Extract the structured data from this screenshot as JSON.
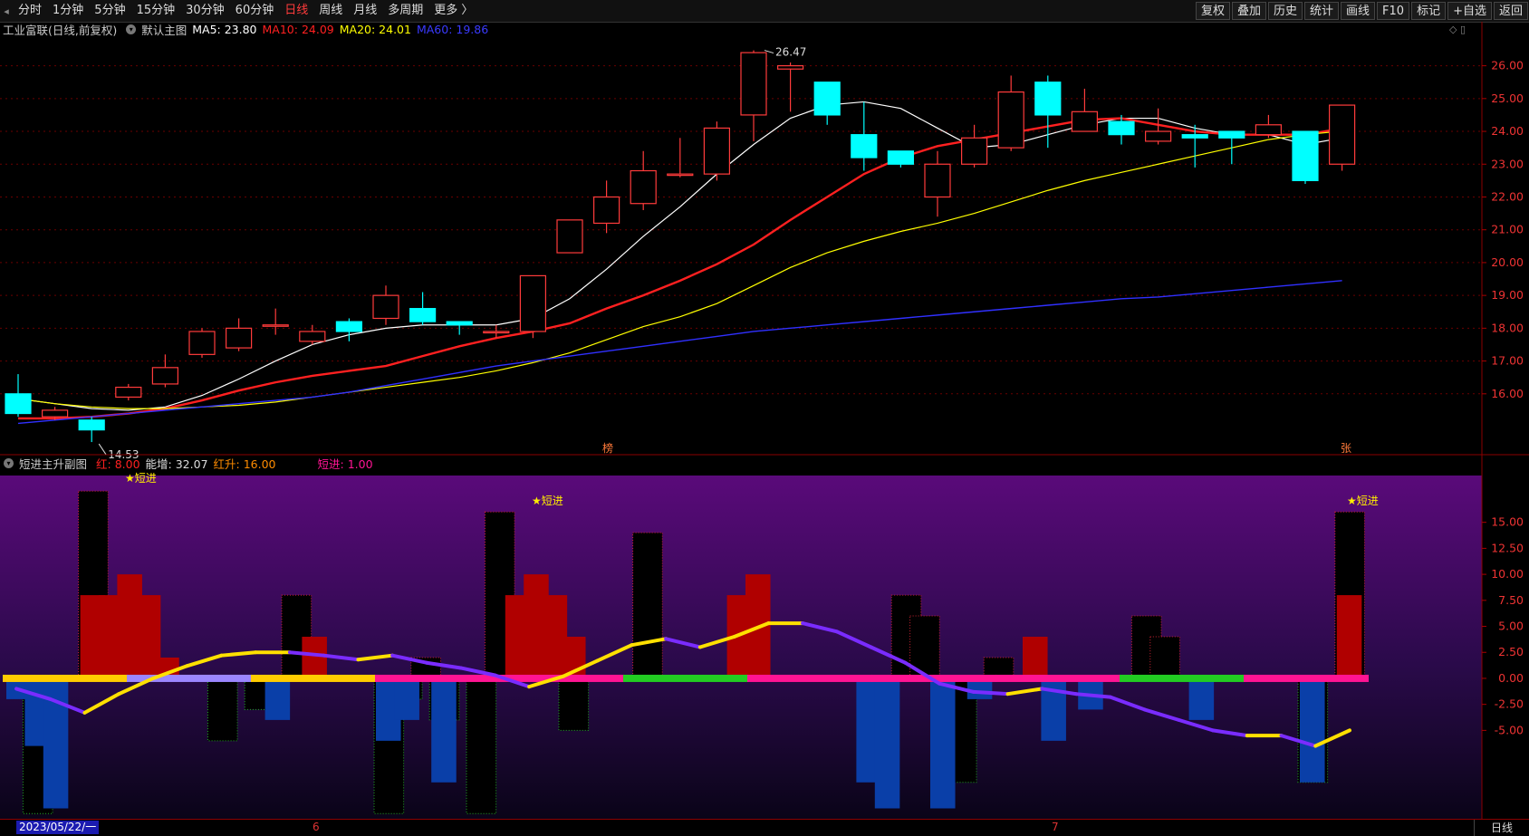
{
  "toolbar": {
    "periods": [
      "分时",
      "1分钟",
      "5分钟",
      "15分钟",
      "30分钟",
      "60分钟",
      "日线",
      "周线",
      "月线",
      "多周期",
      "更多 〉"
    ],
    "active_period": "日线",
    "right_buttons": [
      "复权",
      "叠加",
      "历史",
      "统计",
      "画线",
      "F10",
      "标记",
      "+自选",
      "返回"
    ]
  },
  "main_legend": {
    "title": "工业富联(日线,前复权)",
    "template": "默认主图",
    "ma5": "MA5: 23.80",
    "ma10": "MA10: 24.09",
    "ma20": "MA20: 24.01",
    "ma60": "MA60: 19.86"
  },
  "sub_legend": {
    "title": "短进主升副图",
    "red": "红: 8.00",
    "energy": "能增: 32.07",
    "redrise": "红升: 16.00",
    "short": "短进: 1.00"
  },
  "colors": {
    "ma5": "#ffffff",
    "ma10": "#ff2020",
    "ma20": "#ffff00",
    "ma60": "#3030ff",
    "up": "#ff3b3b",
    "down": "#00ffff"
  },
  "annotations": {
    "high": "26.47",
    "low": "14.53",
    "star": "★短进",
    "bang": "榜",
    "zhang": "张"
  },
  "footer": {
    "date": "2023/05/22/一",
    "month6": "6",
    "month7": "7",
    "tab": "日线"
  },
  "chart_data": [
    {
      "type": "candlestick",
      "yticks": [
        "26.00",
        "25.00",
        "24.00",
        "23.00",
        "22.00",
        "21.00",
        "20.00",
        "19.00",
        "18.00",
        "17.00",
        "16.00"
      ],
      "ylim": [
        14.2,
        26.9
      ],
      "candles": [
        [
          16.0,
          15.4,
          16.6,
          15.3
        ],
        [
          15.3,
          15.5,
          15.6,
          15.2
        ],
        [
          15.2,
          14.9,
          15.3,
          14.53
        ],
        [
          15.9,
          16.2,
          16.3,
          15.8
        ],
        [
          16.3,
          16.8,
          17.2,
          16.2
        ],
        [
          17.2,
          17.9,
          18.0,
          17.1
        ],
        [
          17.4,
          18.0,
          18.3,
          17.3
        ],
        [
          18.1,
          18.1,
          18.6,
          17.8
        ],
        [
          17.6,
          17.9,
          18.1,
          17.5
        ],
        [
          18.2,
          17.9,
          18.3,
          17.6
        ],
        [
          18.3,
          19.0,
          19.3,
          18.1
        ],
        [
          18.6,
          18.2,
          19.1,
          18.1
        ],
        [
          18.2,
          18.1,
          18.2,
          17.8
        ],
        [
          17.9,
          17.9,
          18.1,
          17.7
        ],
        [
          17.9,
          19.6,
          19.6,
          17.7
        ],
        [
          20.3,
          21.3,
          21.3,
          20.3
        ],
        [
          21.2,
          22.0,
          22.5,
          20.9
        ],
        [
          21.8,
          22.8,
          23.4,
          21.6
        ],
        [
          22.7,
          22.7,
          23.8,
          22.6
        ],
        [
          22.7,
          24.1,
          24.3,
          22.5
        ],
        [
          24.5,
          26.4,
          26.47,
          23.7
        ],
        [
          25.9,
          26.0,
          26.1,
          24.6
        ],
        [
          25.5,
          24.5,
          25.5,
          24.2
        ],
        [
          23.9,
          23.2,
          24.9,
          22.8
        ],
        [
          23.4,
          23.0,
          23.4,
          22.9
        ],
        [
          22.0,
          23.0,
          23.4,
          21.4
        ],
        [
          23.0,
          23.8,
          24.2,
          22.9
        ],
        [
          23.5,
          25.2,
          25.7,
          23.4
        ],
        [
          25.5,
          24.5,
          25.7,
          23.5
        ],
        [
          24.0,
          24.6,
          25.3,
          24.0
        ],
        [
          24.3,
          23.9,
          24.5,
          23.6
        ],
        [
          23.7,
          24.0,
          24.7,
          23.6
        ],
        [
          23.9,
          23.8,
          24.2,
          22.9
        ],
        [
          24.0,
          23.8,
          24.0,
          23.0
        ],
        [
          23.9,
          24.2,
          24.5,
          23.8
        ],
        [
          24.0,
          22.5,
          24.0,
          22.4
        ],
        [
          23.0,
          24.8,
          24.8,
          22.8
        ]
      ],
      "series": [
        {
          "name": "MA5",
          "values": [
            15.85,
            15.7,
            15.55,
            15.5,
            15.6,
            15.95,
            16.45,
            17.0,
            17.5,
            17.8,
            18.0,
            18.1,
            18.1,
            18.1,
            18.3,
            18.9,
            19.8,
            20.8,
            21.7,
            22.7,
            23.6,
            24.4,
            24.8,
            24.9,
            24.7,
            24.1,
            23.5,
            23.6,
            23.9,
            24.2,
            24.4,
            24.4,
            24.1,
            23.9,
            23.9,
            23.6,
            23.8
          ]
        },
        {
          "name": "MA10",
          "values": [
            15.25,
            15.25,
            15.3,
            15.4,
            15.55,
            15.8,
            16.1,
            16.35,
            16.55,
            16.7,
            16.85,
            17.15,
            17.45,
            17.7,
            17.9,
            18.15,
            18.6,
            19.0,
            19.45,
            19.95,
            20.55,
            21.3,
            22.0,
            22.7,
            23.2,
            23.55,
            23.75,
            23.95,
            24.15,
            24.35,
            24.4,
            24.2,
            24.0,
            23.9,
            23.9,
            23.9,
            24.09
          ]
        },
        {
          "name": "MA20",
          "values": [
            15.85,
            15.7,
            15.6,
            15.55,
            15.55,
            15.6,
            15.65,
            15.75,
            15.9,
            16.05,
            16.2,
            16.35,
            16.5,
            16.7,
            16.95,
            17.25,
            17.65,
            18.05,
            18.35,
            18.75,
            19.3,
            19.85,
            20.3,
            20.65,
            20.95,
            21.2,
            21.5,
            21.85,
            22.2,
            22.5,
            22.75,
            23.0,
            23.25,
            23.5,
            23.75,
            23.9,
            24.01
          ]
        },
        {
          "name": "MA60",
          "values": [
            15.1,
            15.2,
            15.3,
            15.4,
            15.5,
            15.6,
            15.7,
            15.8,
            15.9,
            16.05,
            16.25,
            16.45,
            16.65,
            16.85,
            17.0,
            17.15,
            17.3,
            17.45,
            17.6,
            17.75,
            17.9,
            18.0,
            18.1,
            18.2,
            18.3,
            18.4,
            18.5,
            18.6,
            18.7,
            18.8,
            18.9,
            18.95,
            19.05,
            19.15,
            19.25,
            19.35,
            19.45
          ]
        }
      ]
    },
    {
      "type": "bar",
      "yticks": [
        "15.00",
        "12.50",
        "10.00",
        "7.50",
        "5.00",
        "2.50",
        "0.00",
        "-2.50",
        "-5.00"
      ],
      "ylim": [
        -13.5,
        19.5
      ],
      "frames": [
        0,
        -13,
        0,
        0,
        18,
        0,
        0,
        0,
        0,
        0,
        0,
        -6,
        0,
        -3,
        0,
        8,
        0,
        0,
        0,
        0,
        -13,
        -2,
        2,
        -4,
        0,
        -13,
        16,
        0,
        0,
        0,
        -5,
        0,
        0,
        0,
        14,
        0,
        0,
        0,
        0,
        0,
        0,
        0,
        0,
        0,
        0,
        0,
        0,
        0,
        8,
        6,
        0,
        -10,
        0,
        2,
        0,
        0,
        0,
        0,
        0,
        0,
        0,
        6,
        4,
        0,
        0,
        0,
        0,
        0,
        0,
        0,
        -10,
        0,
        16
      ],
      "bars_top": [
        -2,
        -6.5,
        -12.5,
        0,
        8,
        8,
        10,
        8,
        2,
        0,
        0,
        0,
        0,
        0,
        -4,
        0,
        4,
        0,
        0,
        0,
        -6,
        -4,
        0,
        -10,
        0,
        0,
        0,
        8,
        10,
        8,
        4,
        0,
        0,
        0,
        0,
        0,
        0,
        0,
        0,
        8,
        10,
        0,
        0,
        0,
        0,
        0,
        -10,
        -12.5,
        0,
        0,
        -12.5,
        0,
        -2,
        0,
        0,
        4,
        -6,
        0,
        -3,
        0,
        0,
        0,
        0,
        0,
        -4,
        0,
        0,
        0,
        0,
        0,
        -10,
        0,
        8
      ],
      "line": [
        -1,
        -2,
        -3.3,
        -1.5,
        0,
        1.2,
        2.2,
        2.5,
        2.5,
        2.2,
        1.8,
        2.2,
        1.5,
        1.0,
        0.3,
        -0.8,
        0.2,
        1.7,
        3.2,
        3.8,
        3.0,
        4.0,
        5.3,
        5.3,
        4.5,
        3.0,
        1.5,
        -0.5,
        -1.3,
        -1.5,
        -1.0,
        -1.5,
        -1.8,
        -3.0,
        -4.0,
        -5.0,
        -5.5,
        -5.5,
        -6.5,
        -5.0
      ],
      "ribbon": [
        "#ffcc00",
        "#9b86ff",
        "#ffcc00",
        "#ff1493",
        "#ff1493",
        "#22cc22",
        "#ff1493",
        "#ff1493",
        "#ff1493",
        "#22cc22",
        "#ff1493"
      ]
    }
  ]
}
